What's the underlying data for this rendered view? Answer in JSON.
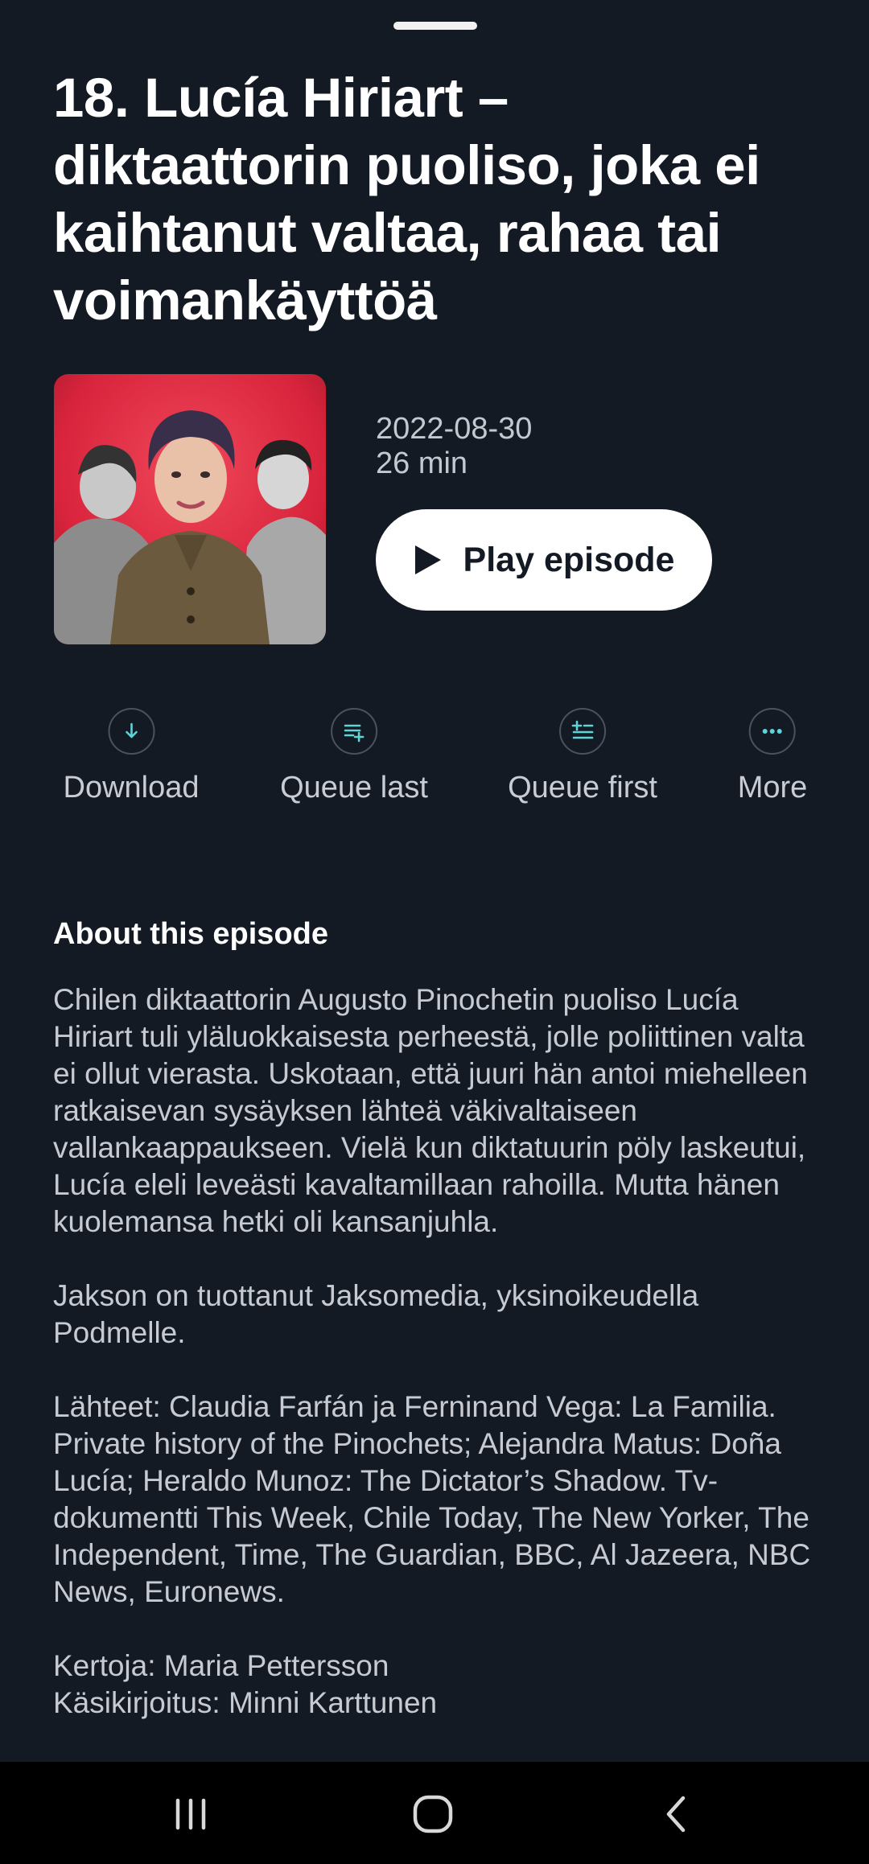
{
  "episode": {
    "title": "18. Lucía Hiriart – diktaattorin puoliso, joka ei kaihtanut valtaa, rahaa tai voimankäyttöä",
    "date": "2022-08-30",
    "duration": "26 min",
    "play_label": "Play episode"
  },
  "actions": [
    {
      "label": "Download",
      "icon": "download-icon"
    },
    {
      "label": "Queue last",
      "icon": "queue-last-icon"
    },
    {
      "label": "Queue first",
      "icon": "queue-first-icon"
    },
    {
      "label": "More",
      "icon": "more-icon"
    }
  ],
  "about": {
    "heading": "About this episode",
    "paragraphs": [
      "Chilen diktaattorin Augusto Pinochetin puoliso Lucía Hiriart tuli yläluokkaisesta perheestä, jolle poliittinen valta ei ollut vierasta. Uskotaan, että juuri hän antoi miehelleen ratkaisevan sysäyksen lähteä väkivaltaiseen vallankaappaukseen. Vielä kun diktatuurin pöly laskeutui, Lucía eleli leveästi kavaltamillaan rahoilla. Mutta hänen kuolemansa hetki oli kansanjuhla.",
      "Jakson on tuottanut Jaksomedia, yksinoikeudella Podmelle.",
      "Lähteet: Claudia Farfán ja Ferninand Vega: La Familia. Private history of the Pinochets; Alejandra Matus: Doña Lucía; Heraldo Munoz: The Dictator’s Shadow. Tv-dokumentti This Week, Chile Today, The New Yorker, The Independent, Time, The Guardian, BBC, Al Jazeera, NBC News, Euronews.",
      "Kertoja: Maria Pettersson\nKäsikirjoitus: Minni Karttunen"
    ]
  },
  "nav": [
    "recent-apps-icon",
    "home-icon",
    "back-icon"
  ],
  "colors": {
    "background": "#141a24",
    "accent": "#5fd3d6",
    "play_button": "#ffffff",
    "cover_red": "#e8324a"
  }
}
